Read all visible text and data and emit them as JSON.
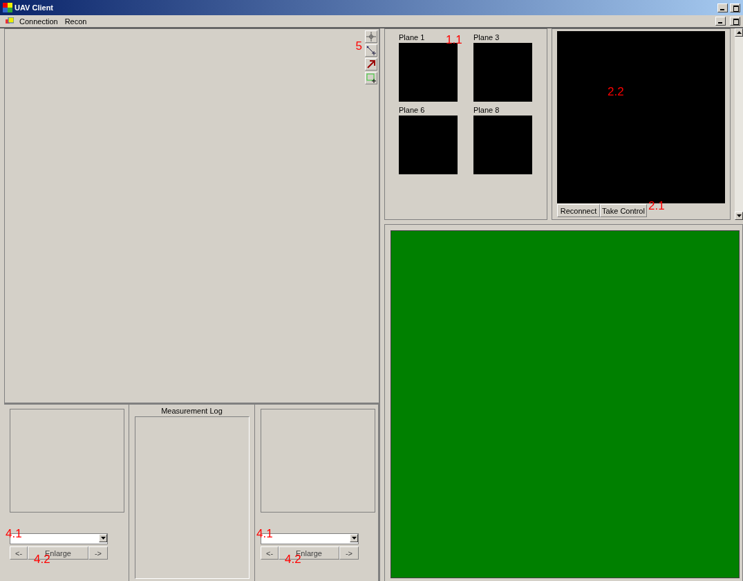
{
  "window": {
    "title": "UAV Client"
  },
  "menu": [
    {
      "label": "Connection"
    },
    {
      "label": "Recon"
    }
  ],
  "map_panel": {
    "annotation": "5",
    "tools": [
      {
        "kind": "crosshair"
      },
      {
        "kind": "line"
      },
      {
        "kind": "arrow"
      },
      {
        "kind": "rectangle"
      }
    ]
  },
  "planes_panel": {
    "annotation": "1.1",
    "planes": [
      {
        "label": "Plane 1"
      },
      {
        "label": "Plane 3"
      },
      {
        "label": "Plane 6"
      },
      {
        "label": "Plane 8"
      }
    ]
  },
  "video_panel": {
    "annotation": "2.2",
    "buttons_annotation": "2.1",
    "buttons": [
      "Reconnect",
      "Take Control"
    ]
  },
  "viewers": [
    {
      "combo_annotation": "4.1",
      "buttons_annotation": "4.2",
      "buttons": [
        "<-",
        "Enlarge",
        "->"
      ]
    },
    {
      "combo_annotation": "4.1",
      "buttons_annotation": "4.2",
      "buttons": [
        "<-",
        "Enlarge",
        "->"
      ]
    }
  ],
  "measurement_log": {
    "title": "Measurement Log"
  }
}
